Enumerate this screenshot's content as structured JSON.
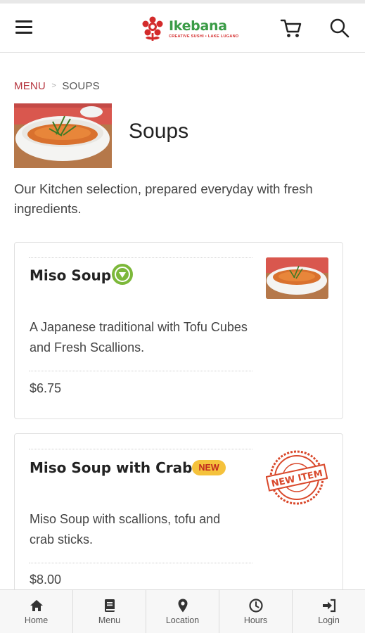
{
  "header": {
    "logo_text": "Ikebana",
    "logo_tagline": "CREATIVE SUSHI • LAKE LUGANO",
    "brand_green": "#3a9b46",
    "brand_red": "#d32b2b"
  },
  "breadcrumb": {
    "root": "MENU",
    "separator": ">",
    "current": "SOUPS"
  },
  "category": {
    "title": "Soups",
    "description": "Our Kitchen selection, prepared everyday with fresh ingredients."
  },
  "items": [
    {
      "name": "Miso Soup",
      "badge_icon": "vegetarian-leaf-icon",
      "description": "A Japanese traditional with Tofu Cubes and Fresh Scallions.",
      "price": "$6.75"
    },
    {
      "name": "Miso Soup with Crab",
      "badge": "NEW",
      "stamp_text": "NEW ITEM",
      "description": "Miso Soup with scallions, tofu and crab sticks.",
      "price": "$8.00"
    }
  ],
  "bottom_nav": [
    {
      "label": "Home",
      "icon": "home-icon"
    },
    {
      "label": "Menu",
      "icon": "book-icon"
    },
    {
      "label": "Location",
      "icon": "map-pin-icon"
    },
    {
      "label": "Hours",
      "icon": "clock-icon"
    },
    {
      "label": "Login",
      "icon": "sign-in-icon"
    }
  ],
  "colors": {
    "accent_red": "#b5343e",
    "veg_green": "#7cb83a",
    "new_badge_yellow": "#f5c23c"
  }
}
